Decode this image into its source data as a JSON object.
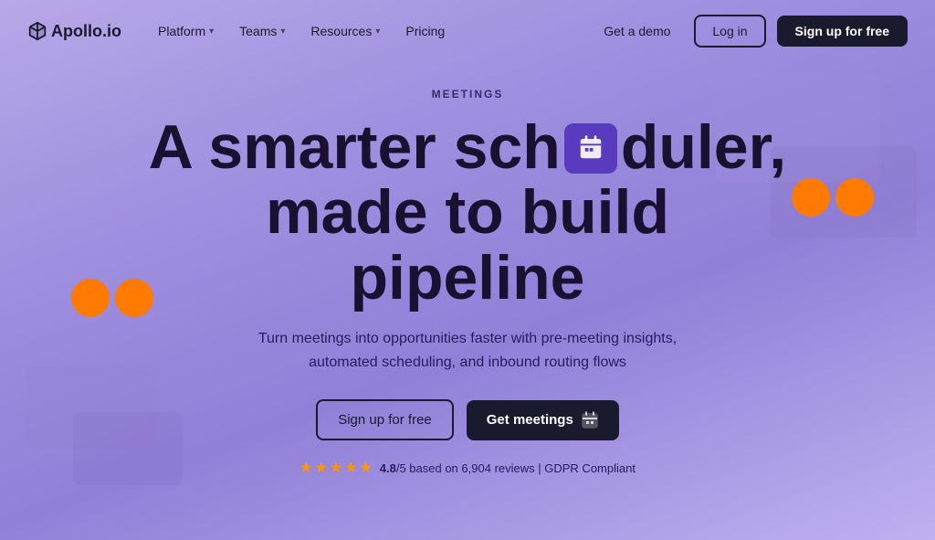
{
  "brand": {
    "name": "Apollo.io"
  },
  "navbar": {
    "platform_label": "Platform",
    "teams_label": "Teams",
    "resources_label": "Resources",
    "pricing_label": "Pricing",
    "demo_label": "Get a demo",
    "login_label": "Log in",
    "signup_label": "Sign up for free"
  },
  "hero": {
    "label": "MEETINGS",
    "title_part1": "A smarter sch",
    "title_part2": "duler,",
    "title_line2": "made to build",
    "title_line3": "pipeline",
    "subtitle": "Turn meetings into opportunities faster with pre-meeting insights, automated scheduling, and inbound routing flows",
    "cta_signup": "Sign up for free",
    "cta_meetings": "Get meetings",
    "rating_score": "4.8",
    "rating_count": "6,904",
    "rating_label": "based on",
    "rating_suffix": "reviews | GDPR Compliant"
  },
  "colors": {
    "bg_gradient_start": "#b8a8e8",
    "bg_gradient_end": "#9080d8",
    "orange": "#ff7a00",
    "dark": "#1a1a2e"
  }
}
